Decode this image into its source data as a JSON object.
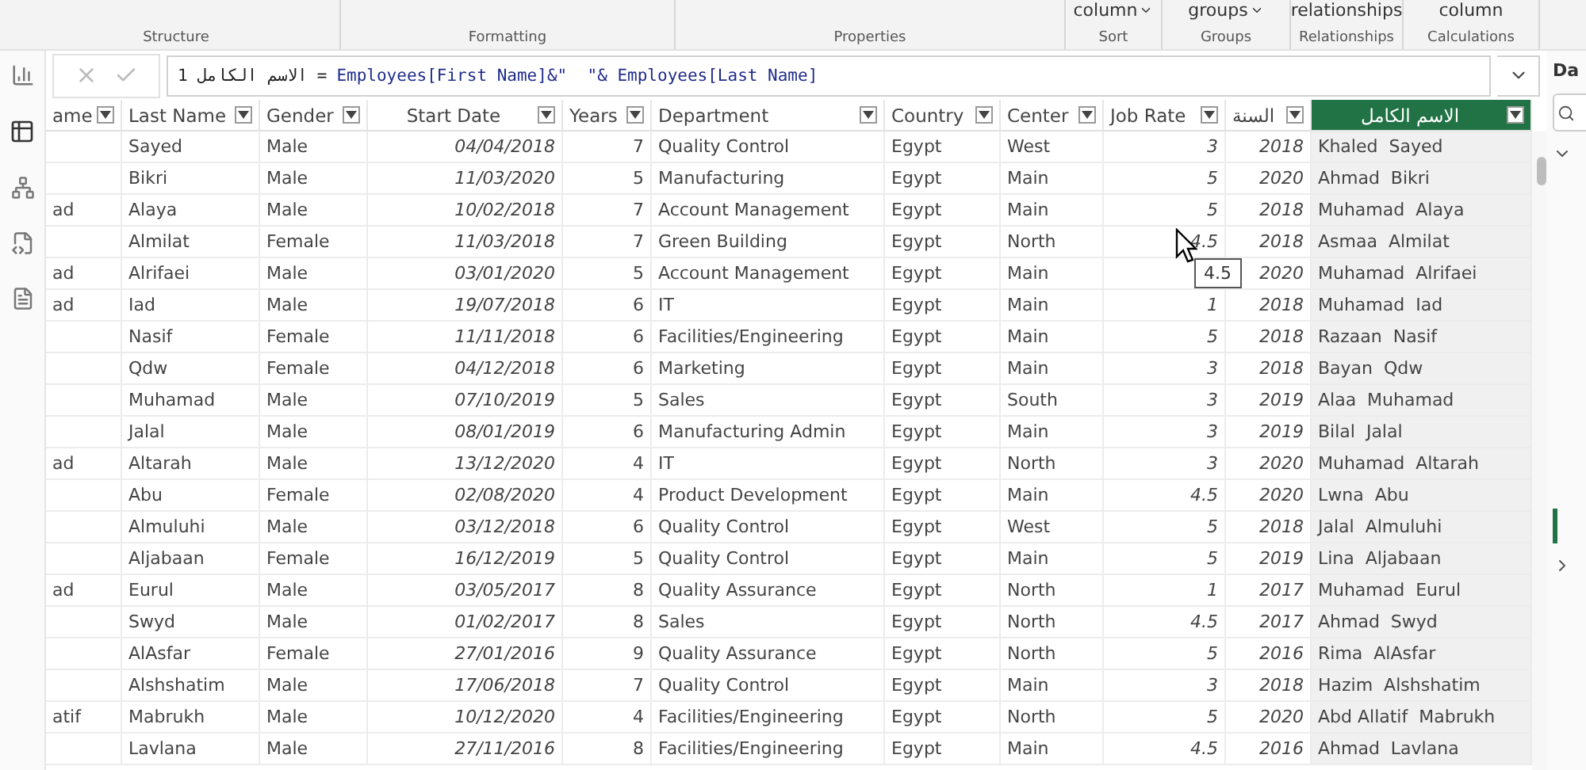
{
  "ribbon": {
    "buttons": [
      {
        "label": "column",
        "dropdown": true
      },
      {
        "label": "groups",
        "dropdown": true
      },
      {
        "label": "relationships",
        "dropdown": false
      },
      {
        "label": "column",
        "dropdown": false
      }
    ],
    "groups": [
      "Structure",
      "Formatting",
      "Properties",
      "Sort",
      "Groups",
      "Relationships",
      "Calculations"
    ]
  },
  "formula_bar": {
    "line_number": "1",
    "column_name": "الاسم الكامل",
    "operator": "=",
    "expression": "Employees[First Name]&\"  \"& Employees[Last Name]"
  },
  "table": {
    "columns": [
      {
        "label": "ame",
        "kind": "text",
        "selected": false
      },
      {
        "label": "Last Name",
        "kind": "text",
        "selected": false
      },
      {
        "label": "Gender",
        "kind": "text",
        "selected": false
      },
      {
        "label": "Start Date",
        "kind": "date",
        "selected": false
      },
      {
        "label": "Years",
        "kind": "integer",
        "selected": false
      },
      {
        "label": "Department",
        "kind": "text",
        "selected": false
      },
      {
        "label": "Country",
        "kind": "text",
        "selected": false
      },
      {
        "label": "Center",
        "kind": "text",
        "selected": false
      },
      {
        "label": "Job Rate",
        "kind": "decimal",
        "selected": false
      },
      {
        "label": "السنة",
        "kind": "calculated",
        "selected": false
      },
      {
        "label": "الاسم الكامل",
        "kind": "text",
        "selected": true
      }
    ],
    "rows": [
      [
        null,
        "Sayed",
        "Male",
        "04/04/2018",
        "7",
        "Quality Control",
        "Egypt",
        "West",
        "3",
        "2018",
        "Khaled  Sayed"
      ],
      [
        null,
        "Bikri",
        "Male",
        "11/03/2020",
        "5",
        "Manufacturing",
        "Egypt",
        "Main",
        "5",
        "2020",
        "Ahmad  Bikri"
      ],
      [
        "ad",
        "Alaya",
        "Male",
        "10/02/2018",
        "7",
        "Account Management",
        "Egypt",
        "Main",
        "5",
        "2018",
        "Muhamad  Alaya"
      ],
      [
        null,
        "Almilat",
        "Female",
        "11/03/2018",
        "7",
        "Green Building",
        "Egypt",
        "North",
        "4.5",
        "2018",
        "Asmaa  Almilat"
      ],
      [
        "ad",
        "Alrifaei",
        "Male",
        "03/01/2020",
        "5",
        "Account Management",
        "Egypt",
        "Main",
        null,
        "2020",
        "Muhamad  Alrifaei"
      ],
      [
        "ad",
        "Iad",
        "Male",
        "19/07/2018",
        "6",
        "IT",
        "Egypt",
        "Main",
        "1",
        "2018",
        "Muhamad  Iad"
      ],
      [
        null,
        "Nasif",
        "Female",
        "11/11/2018",
        "6",
        "Facilities/Engineering",
        "Egypt",
        "Main",
        "5",
        "2018",
        "Razaan  Nasif"
      ],
      [
        null,
        "Qdw",
        "Female",
        "04/12/2018",
        "6",
        "Marketing",
        "Egypt",
        "Main",
        "3",
        "2018",
        "Bayan  Qdw"
      ],
      [
        null,
        "Muhamad",
        "Male",
        "07/10/2019",
        "5",
        "Sales",
        "Egypt",
        "South",
        "3",
        "2019",
        "Alaa  Muhamad"
      ],
      [
        null,
        "Jalal",
        "Male",
        "08/01/2019",
        "6",
        "Manufacturing Admin",
        "Egypt",
        "Main",
        "3",
        "2019",
        "Bilal  Jalal"
      ],
      [
        "ad",
        "Altarah",
        "Male",
        "13/12/2020",
        "4",
        "IT",
        "Egypt",
        "North",
        "3",
        "2020",
        "Muhamad  Altarah"
      ],
      [
        null,
        "Abu",
        "Female",
        "02/08/2020",
        "4",
        "Product Development",
        "Egypt",
        "Main",
        "4.5",
        "2020",
        "Lwna  Abu"
      ],
      [
        null,
        "Almuluhi",
        "Male",
        "03/12/2018",
        "6",
        "Quality Control",
        "Egypt",
        "West",
        "5",
        "2018",
        "Jalal  Almuluhi"
      ],
      [
        null,
        "Aljabaan",
        "Female",
        "16/12/2019",
        "5",
        "Quality Control",
        "Egypt",
        "Main",
        "5",
        "2019",
        "Lina  Aljabaan"
      ],
      [
        "ad",
        "Eurul",
        "Male",
        "03/05/2017",
        "8",
        "Quality Assurance",
        "Egypt",
        "North",
        "1",
        "2017",
        "Muhamad  Eurul"
      ],
      [
        null,
        "Swyd",
        "Male",
        "01/02/2017",
        "8",
        "Sales",
        "Egypt",
        "North",
        "4.5",
        "2017",
        "Ahmad  Swyd"
      ],
      [
        null,
        "AlAsfar",
        "Female",
        "27/01/2016",
        "9",
        "Quality Assurance",
        "Egypt",
        "North",
        "5",
        "2016",
        "Rima  AlAsfar"
      ],
      [
        null,
        "Alshshatim",
        "Male",
        "17/06/2018",
        "7",
        "Quality Control",
        "Egypt",
        "Main",
        "3",
        "2018",
        "Hazim  Alshshatim"
      ],
      [
        "atif",
        "Mabrukh",
        "Male",
        "10/12/2020",
        "4",
        "Facilities/Engineering",
        "Egypt",
        "North",
        "5",
        "2020",
        "Abd Allatif  Mabrukh"
      ],
      [
        null,
        "Lavlana",
        "Male",
        "27/11/2016",
        "8",
        "Facilities/Engineering",
        "Egypt",
        "Main",
        "4.5",
        "2016",
        "Ahmad  Lavlana"
      ]
    ],
    "tooltip": "4.5"
  },
  "side_pane": {
    "title": "Da"
  }
}
